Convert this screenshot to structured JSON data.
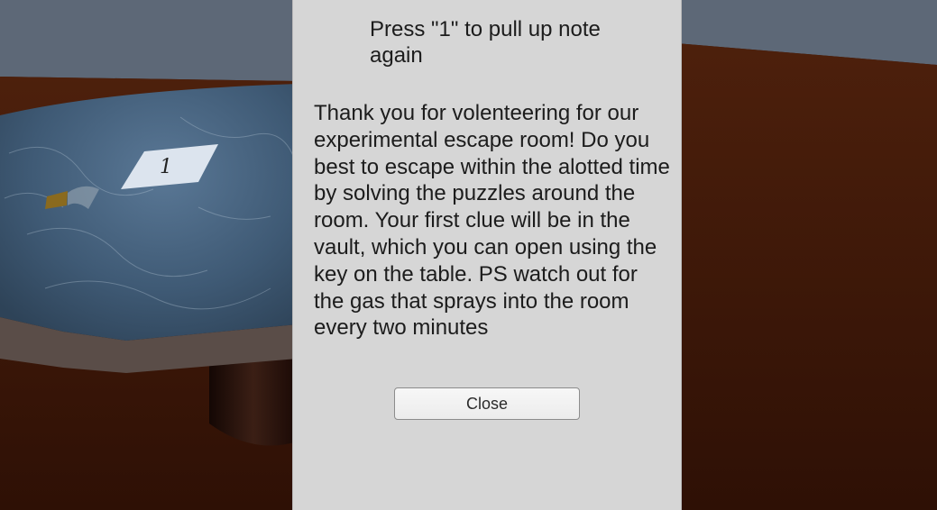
{
  "note": {
    "hint": "Press \"1\" to pull up note again",
    "body": "Thank you for volenteering for our experimental escape room! Do you best to escape within the alotted time by solving the puzzles around the room. Your first clue will be in the vault, which you can open using the key on the table. PS watch out for the gas that sprays into the room every two minutes",
    "close_label": "Close"
  },
  "scene": {
    "paper_label": "1"
  },
  "colors": {
    "panel_bg": "#d6d6d6",
    "text": "#1c1c1c",
    "wall": "#5d6877",
    "floor": "#4a1e0a",
    "marble": "#46607a"
  }
}
